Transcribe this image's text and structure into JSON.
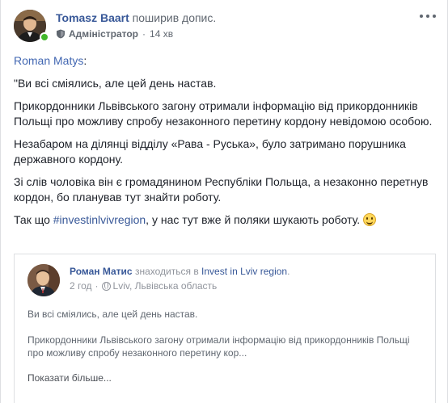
{
  "post": {
    "author": "Tomasz Baart",
    "action": "поширив допис.",
    "role": "Адміністратор",
    "separator": "·",
    "time": "14 хв",
    "mention": "Roman Matys",
    "mention_suffix": ":",
    "paragraphs": [
      "\"Ви всі сміялись, але цей день настав.",
      "Прикордонники Львівського загону отримали інформацію від прикордонників Польщі про можливу спробу незаконного перетину кордону невідомою особою.",
      "Незабаром на ділянці відділу «Рава - Руська», було затримано порушника державного кордону.",
      "Зі слів чоловіка він є громадянином Республіки Польща, а незаконно перетнув кордон, бо планував тут знайти роботу."
    ],
    "last_prefix": "Так що ",
    "hashtag": "#investinlvivregion",
    "last_suffix": ", у нас тут вже й поляки шукають роботу. "
  },
  "shared": {
    "author": "Роман Матис",
    "location_prefix": "знаходиться в",
    "location_page": "Invest in Lviv region",
    "location_suffix": ".",
    "time": "2 год",
    "dot": "·",
    "place": "Lviv, Львівська область",
    "paragraphs": [
      "Ви всі сміялись, але цей день настав.",
      "Прикордонники Львівського загону отримали інформацію від прикордонників Польщі про можливу спробу незаконного перетину кор..."
    ],
    "see_more": "Показати більше..."
  },
  "icons": {
    "role": "admin-shield-icon",
    "more": "more-options-icon",
    "privacy": "globe-icon",
    "emoji": "smiley-emoji-icon"
  },
  "colors": {
    "link": "#385898",
    "online": "#42b72a",
    "muted": "#90949c"
  }
}
